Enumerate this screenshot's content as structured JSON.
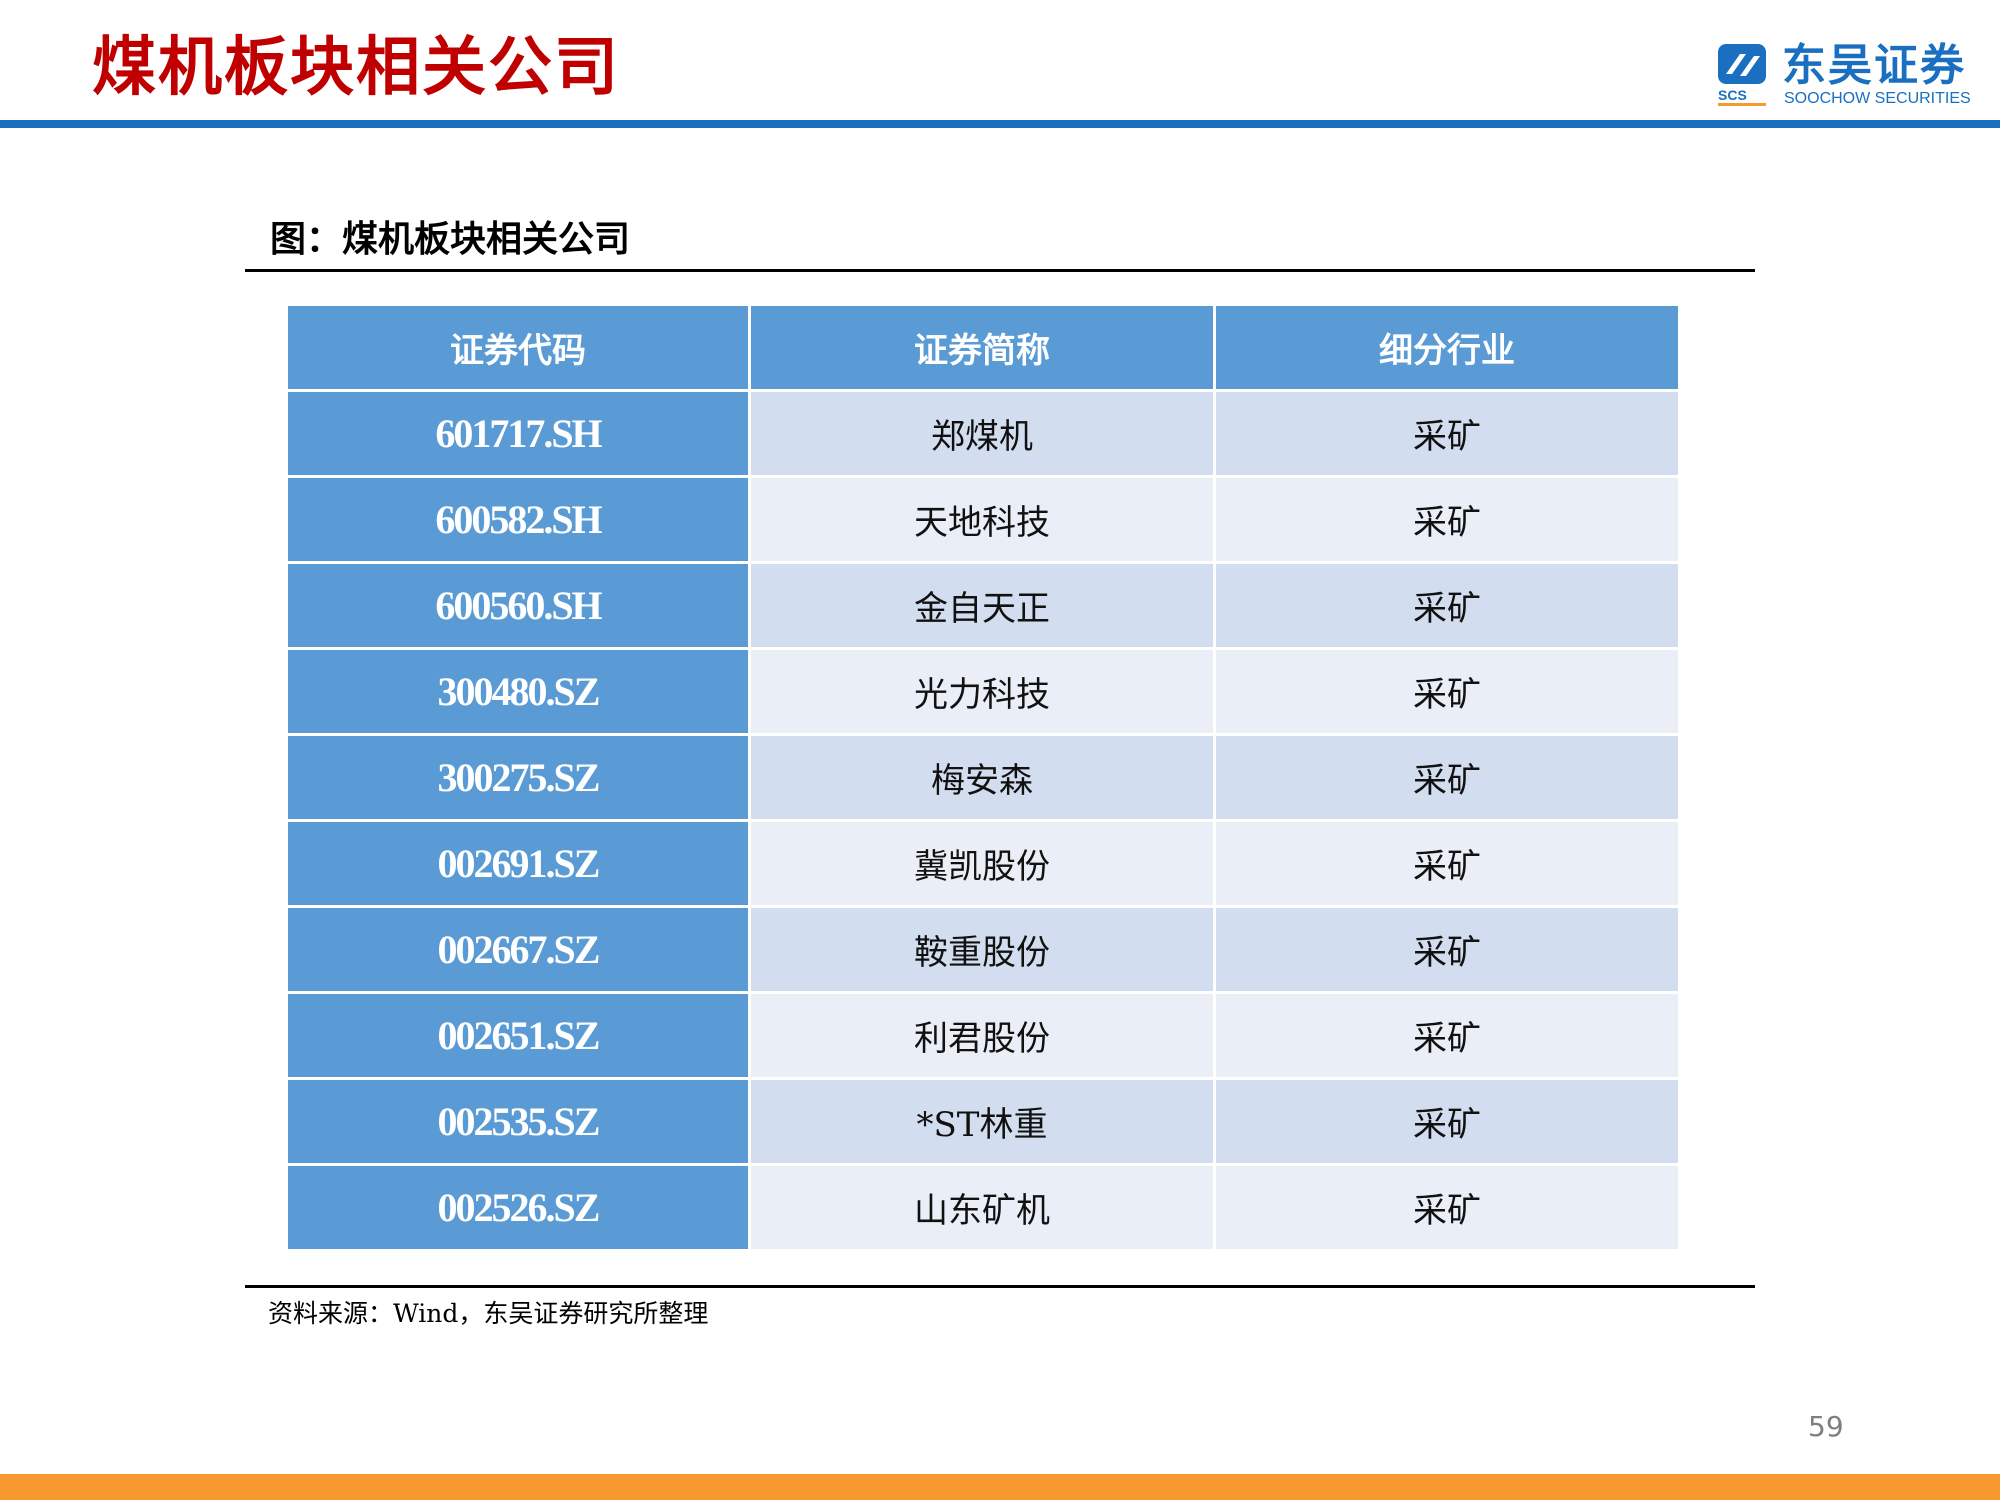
{
  "header": {
    "title": "煤机板块相关公司",
    "logo": {
      "cn": "东吴证券",
      "en": "SOOCHOW SECURITIES",
      "abbr": "SCS"
    }
  },
  "figure": {
    "title": "图：煤机板块相关公司",
    "table": {
      "headers": [
        "证券代码",
        "证券简称",
        "细分行业"
      ],
      "rows": [
        [
          "601717.SH",
          "郑煤机",
          "采矿"
        ],
        [
          "600582.SH",
          "天地科技",
          "采矿"
        ],
        [
          "600560.SH",
          "金自天正",
          "采矿"
        ],
        [
          "300480.SZ",
          "光力科技",
          "采矿"
        ],
        [
          "300275.SZ",
          "梅安森",
          "采矿"
        ],
        [
          "002691.SZ",
          "冀凯股份",
          "采矿"
        ],
        [
          "002667.SZ",
          "鞍重股份",
          "采矿"
        ],
        [
          "002651.SZ",
          "利君股份",
          "采矿"
        ],
        [
          "002535.SZ",
          "*ST林重",
          "采矿"
        ],
        [
          "002526.SZ",
          "山东矿机",
          "采矿"
        ]
      ]
    },
    "source": "资料来源：Wind，东吴证券研究所整理"
  },
  "footer": {
    "page_number": "59"
  },
  "colors": {
    "title_red": "#c00000",
    "brand_blue": "#1a6fc0",
    "header_cell": "#5b9bd5",
    "row_dark": "#d2deef",
    "row_light": "#eaeff7",
    "bottom_bar": "#f7992f"
  }
}
